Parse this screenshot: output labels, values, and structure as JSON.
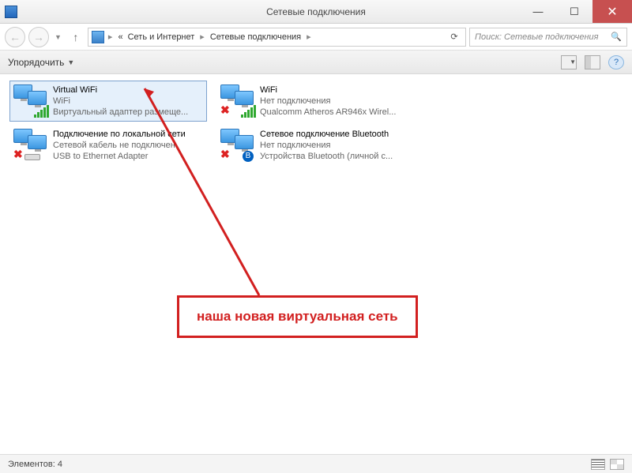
{
  "titlebar": {
    "title": "Сетевые подключения"
  },
  "navbar": {
    "path": {
      "prefix": "«",
      "seg1": "Сеть и Интернет",
      "seg2": "Сетевые подключения"
    },
    "search_placeholder": "Поиск: Сетевые подключения"
  },
  "toolbar": {
    "organize": "Упорядочить"
  },
  "items": [
    {
      "name": "Virtual WiFi",
      "status": "WiFi",
      "device": "Виртуальный адаптер размеще...",
      "icon": "wifi",
      "disabled": false,
      "selected": true
    },
    {
      "name": "WiFi",
      "status": "Нет подключения",
      "device": "Qualcomm Atheros AR946x Wirel...",
      "icon": "wifi",
      "disabled": true,
      "selected": false
    },
    {
      "name": "Подключение по локальной сети",
      "status": "Сетевой кабель не подключен",
      "device": "USB to Ethernet Adapter",
      "icon": "ethernet",
      "disabled": true,
      "selected": false
    },
    {
      "name": "Сетевое подключение Bluetooth",
      "status": "Нет подключения",
      "device": "Устройства Bluetooth (личной с...",
      "icon": "bluetooth",
      "disabled": true,
      "selected": false
    }
  ],
  "annotation": {
    "text": "наша новая виртуальная сеть"
  },
  "statusbar": {
    "count_label": "Элементов: 4"
  }
}
